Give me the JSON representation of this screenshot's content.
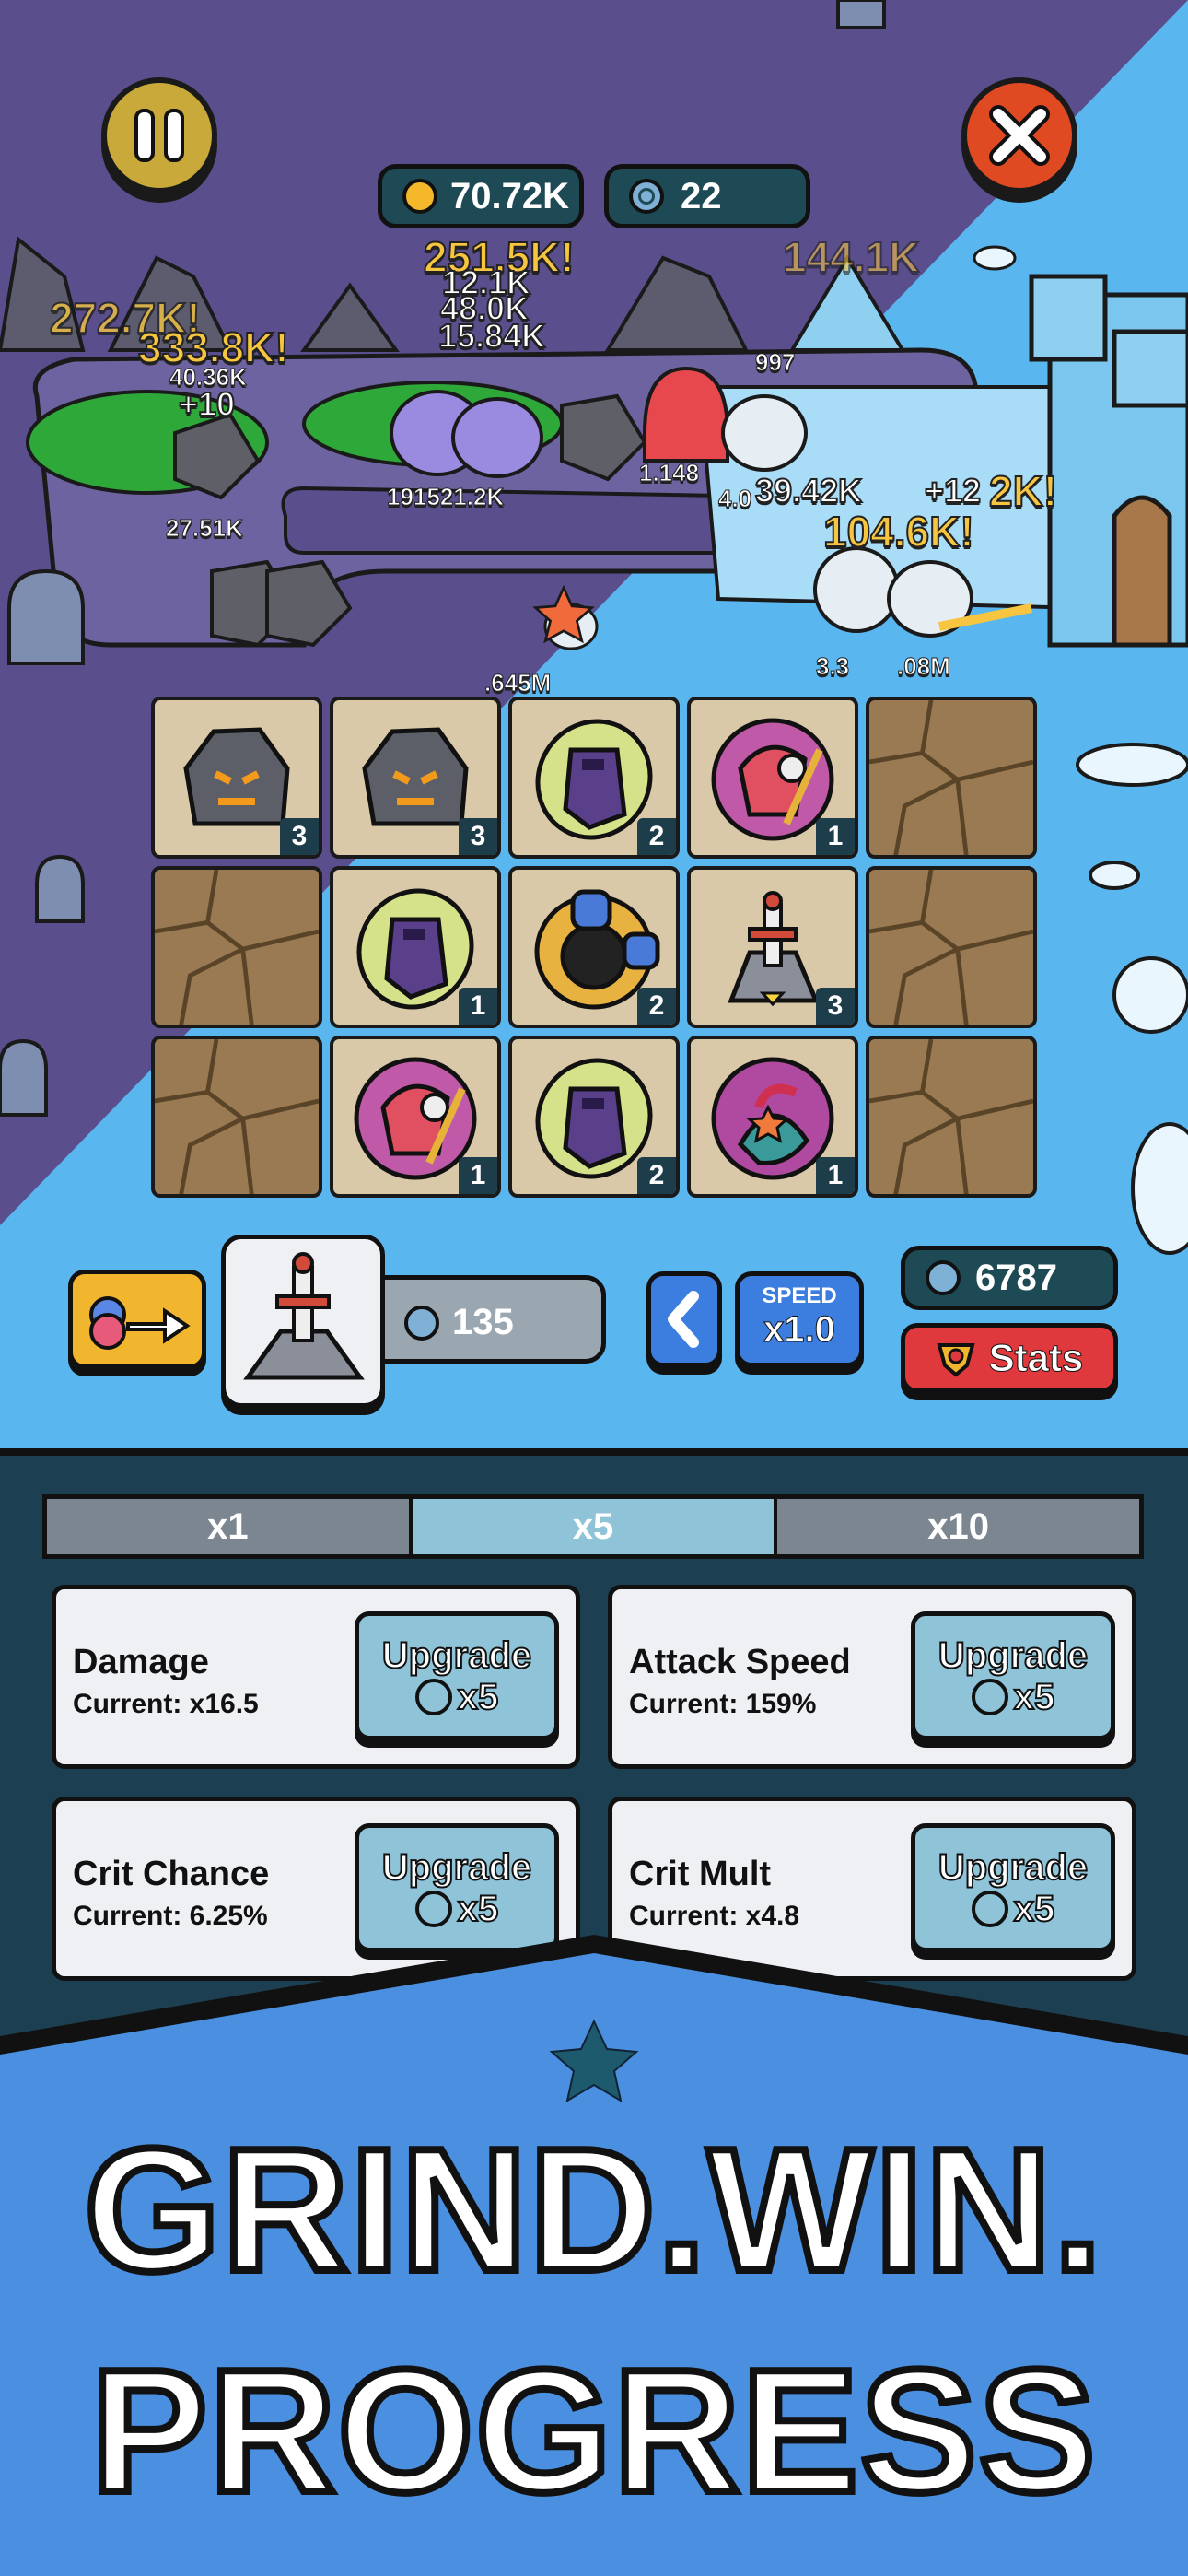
{
  "currency": {
    "coins": "70.72K",
    "gems": "22"
  },
  "buttons": {
    "pause": "pause",
    "close": "close"
  },
  "floaters": [
    {
      "text": "251.5K!",
      "style": "gold"
    },
    {
      "text": "144.1K",
      "style": "gold"
    },
    {
      "text": "272.7K!",
      "style": "gold"
    },
    {
      "text": "333.8K!",
      "style": "gold"
    },
    {
      "text": "12.1K",
      "style": "white"
    },
    {
      "text": "48.0K",
      "style": "white"
    },
    {
      "text": "15.84K",
      "style": "white"
    },
    {
      "text": "40.36K",
      "style": "white"
    },
    {
      "text": "+10",
      "style": "white"
    },
    {
      "text": "27.51K",
      "style": "white"
    },
    {
      "text": "191521.2K",
      "style": "white"
    },
    {
      "text": "1.148",
      "style": "white"
    },
    {
      "text": "997",
      "style": "white"
    },
    {
      "text": "39.42K",
      "style": "white"
    },
    {
      "text": "+12",
      "style": "white"
    },
    {
      "text": "2K!",
      "style": "gold"
    },
    {
      "text": "104.6K!",
      "style": "gold"
    },
    {
      "text": "3.3",
      "style": "white"
    },
    {
      "text": ".08M",
      "style": "white"
    },
    {
      "text": ".645M",
      "style": "white"
    },
    {
      "text": "4.0",
      "style": "white"
    }
  ],
  "grid": [
    [
      {
        "unit": "rock-golem-icon",
        "level": "3"
      },
      {
        "unit": "rock-golem-icon",
        "level": "3"
      },
      {
        "unit": "dark-knight-icon",
        "level": "2"
      },
      {
        "unit": "red-mage-icon",
        "level": "1"
      },
      {
        "unit": "empty",
        "level": ""
      }
    ],
    [
      {
        "unit": "empty",
        "level": ""
      },
      {
        "unit": "dark-knight-icon",
        "level": "1"
      },
      {
        "unit": "bomb-knight-icon",
        "level": "2"
      },
      {
        "unit": "sword-stone-icon",
        "level": "3"
      },
      {
        "unit": "empty",
        "level": ""
      }
    ],
    [
      {
        "unit": "empty",
        "level": ""
      },
      {
        "unit": "red-mage-icon",
        "level": "1"
      },
      {
        "unit": "dark-knight-icon",
        "level": "2"
      },
      {
        "unit": "mermaid-icon",
        "level": "1"
      },
      {
        "unit": "empty",
        "level": ""
      }
    ]
  ],
  "controls": {
    "buy_cost": "135",
    "speed_label": "SPEED",
    "speed_value": "x1.0",
    "currency2": "6787",
    "stats_label": "Stats"
  },
  "tabs": [
    {
      "label": "x1",
      "active": false
    },
    {
      "label": "x5",
      "active": true
    },
    {
      "label": "x10",
      "active": false
    }
  ],
  "upgrades": [
    {
      "name": "Damage",
      "current": "Current: x16.5",
      "button": "Upgrade",
      "amount": "x5"
    },
    {
      "name": "Attack Speed",
      "current": "Current: 159%",
      "button": "Upgrade",
      "amount": "x5"
    },
    {
      "name": "Crit Chance",
      "current": "Current: 6.25%",
      "button": "Upgrade",
      "amount": "x5"
    },
    {
      "name": "Crit Mult",
      "current": "Current: x4.8",
      "button": "Upgrade",
      "amount": "x5"
    }
  ],
  "banner": {
    "line1": "GRIND.WIN.",
    "line2": "PROGRESS"
  },
  "colors": {
    "dark_theme": "#5a4e8c",
    "ice_theme": "#5ab6ee",
    "panel": "#1d3f52",
    "banner": "#4a8fe0",
    "accent_gold": "#f7c540",
    "stats_red": "#e0393d"
  }
}
